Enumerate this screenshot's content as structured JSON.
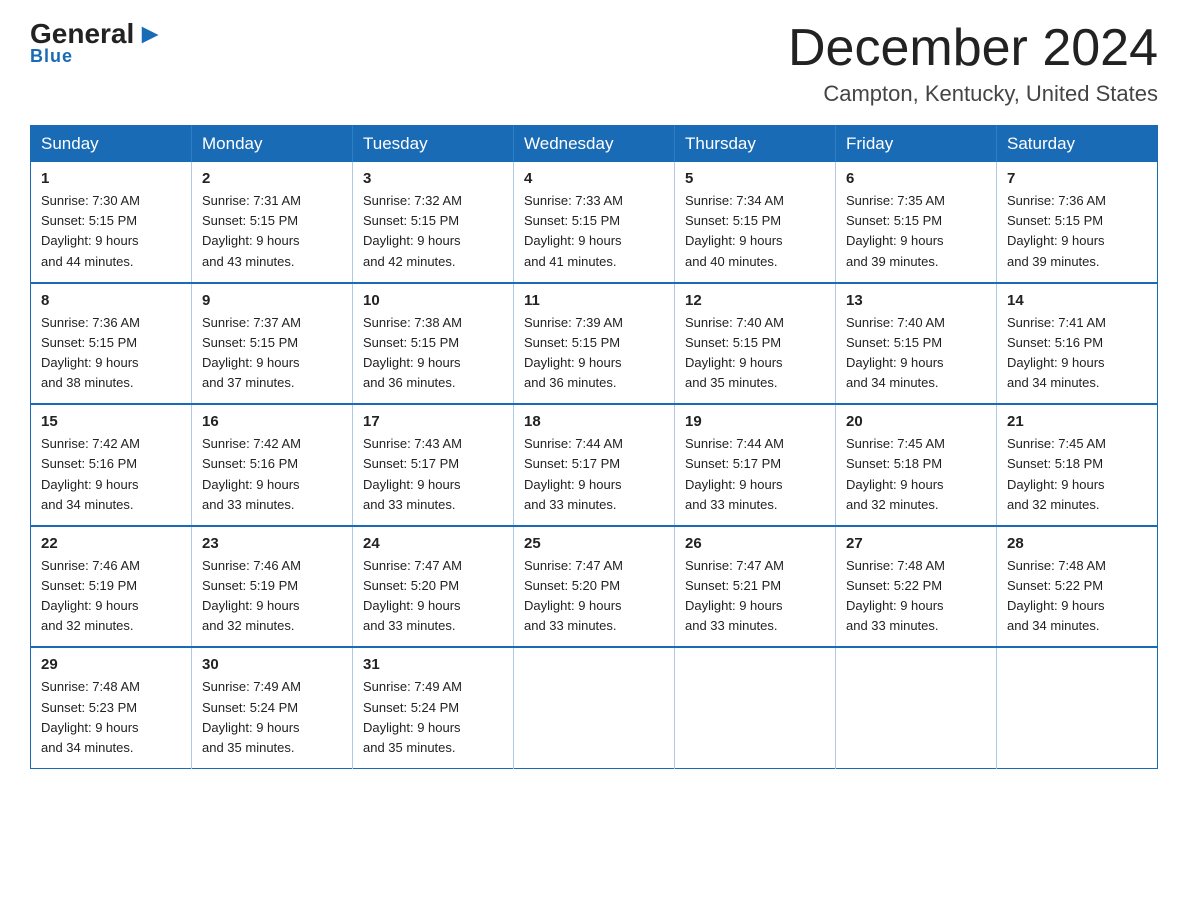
{
  "logo": {
    "general": "General",
    "triangle": "",
    "blue": "Blue"
  },
  "header": {
    "month_title": "December 2024",
    "location": "Campton, Kentucky, United States"
  },
  "weekdays": [
    "Sunday",
    "Monday",
    "Tuesday",
    "Wednesday",
    "Thursday",
    "Friday",
    "Saturday"
  ],
  "weeks": [
    [
      {
        "day": "1",
        "sunrise": "7:30 AM",
        "sunset": "5:15 PM",
        "daylight": "9 hours and 44 minutes."
      },
      {
        "day": "2",
        "sunrise": "7:31 AM",
        "sunset": "5:15 PM",
        "daylight": "9 hours and 43 minutes."
      },
      {
        "day": "3",
        "sunrise": "7:32 AM",
        "sunset": "5:15 PM",
        "daylight": "9 hours and 42 minutes."
      },
      {
        "day": "4",
        "sunrise": "7:33 AM",
        "sunset": "5:15 PM",
        "daylight": "9 hours and 41 minutes."
      },
      {
        "day": "5",
        "sunrise": "7:34 AM",
        "sunset": "5:15 PM",
        "daylight": "9 hours and 40 minutes."
      },
      {
        "day": "6",
        "sunrise": "7:35 AM",
        "sunset": "5:15 PM",
        "daylight": "9 hours and 39 minutes."
      },
      {
        "day": "7",
        "sunrise": "7:36 AM",
        "sunset": "5:15 PM",
        "daylight": "9 hours and 39 minutes."
      }
    ],
    [
      {
        "day": "8",
        "sunrise": "7:36 AM",
        "sunset": "5:15 PM",
        "daylight": "9 hours and 38 minutes."
      },
      {
        "day": "9",
        "sunrise": "7:37 AM",
        "sunset": "5:15 PM",
        "daylight": "9 hours and 37 minutes."
      },
      {
        "day": "10",
        "sunrise": "7:38 AM",
        "sunset": "5:15 PM",
        "daylight": "9 hours and 36 minutes."
      },
      {
        "day": "11",
        "sunrise": "7:39 AM",
        "sunset": "5:15 PM",
        "daylight": "9 hours and 36 minutes."
      },
      {
        "day": "12",
        "sunrise": "7:40 AM",
        "sunset": "5:15 PM",
        "daylight": "9 hours and 35 minutes."
      },
      {
        "day": "13",
        "sunrise": "7:40 AM",
        "sunset": "5:15 PM",
        "daylight": "9 hours and 34 minutes."
      },
      {
        "day": "14",
        "sunrise": "7:41 AM",
        "sunset": "5:16 PM",
        "daylight": "9 hours and 34 minutes."
      }
    ],
    [
      {
        "day": "15",
        "sunrise": "7:42 AM",
        "sunset": "5:16 PM",
        "daylight": "9 hours and 34 minutes."
      },
      {
        "day": "16",
        "sunrise": "7:42 AM",
        "sunset": "5:16 PM",
        "daylight": "9 hours and 33 minutes."
      },
      {
        "day": "17",
        "sunrise": "7:43 AM",
        "sunset": "5:17 PM",
        "daylight": "9 hours and 33 minutes."
      },
      {
        "day": "18",
        "sunrise": "7:44 AM",
        "sunset": "5:17 PM",
        "daylight": "9 hours and 33 minutes."
      },
      {
        "day": "19",
        "sunrise": "7:44 AM",
        "sunset": "5:17 PM",
        "daylight": "9 hours and 33 minutes."
      },
      {
        "day": "20",
        "sunrise": "7:45 AM",
        "sunset": "5:18 PM",
        "daylight": "9 hours and 32 minutes."
      },
      {
        "day": "21",
        "sunrise": "7:45 AM",
        "sunset": "5:18 PM",
        "daylight": "9 hours and 32 minutes."
      }
    ],
    [
      {
        "day": "22",
        "sunrise": "7:46 AM",
        "sunset": "5:19 PM",
        "daylight": "9 hours and 32 minutes."
      },
      {
        "day": "23",
        "sunrise": "7:46 AM",
        "sunset": "5:19 PM",
        "daylight": "9 hours and 32 minutes."
      },
      {
        "day": "24",
        "sunrise": "7:47 AM",
        "sunset": "5:20 PM",
        "daylight": "9 hours and 33 minutes."
      },
      {
        "day": "25",
        "sunrise": "7:47 AM",
        "sunset": "5:20 PM",
        "daylight": "9 hours and 33 minutes."
      },
      {
        "day": "26",
        "sunrise": "7:47 AM",
        "sunset": "5:21 PM",
        "daylight": "9 hours and 33 minutes."
      },
      {
        "day": "27",
        "sunrise": "7:48 AM",
        "sunset": "5:22 PM",
        "daylight": "9 hours and 33 minutes."
      },
      {
        "day": "28",
        "sunrise": "7:48 AM",
        "sunset": "5:22 PM",
        "daylight": "9 hours and 34 minutes."
      }
    ],
    [
      {
        "day": "29",
        "sunrise": "7:48 AM",
        "sunset": "5:23 PM",
        "daylight": "9 hours and 34 minutes."
      },
      {
        "day": "30",
        "sunrise": "7:49 AM",
        "sunset": "5:24 PM",
        "daylight": "9 hours and 35 minutes."
      },
      {
        "day": "31",
        "sunrise": "7:49 AM",
        "sunset": "5:24 PM",
        "daylight": "9 hours and 35 minutes."
      },
      null,
      null,
      null,
      null
    ]
  ],
  "labels": {
    "sunrise": "Sunrise:",
    "sunset": "Sunset:",
    "daylight": "Daylight:"
  }
}
